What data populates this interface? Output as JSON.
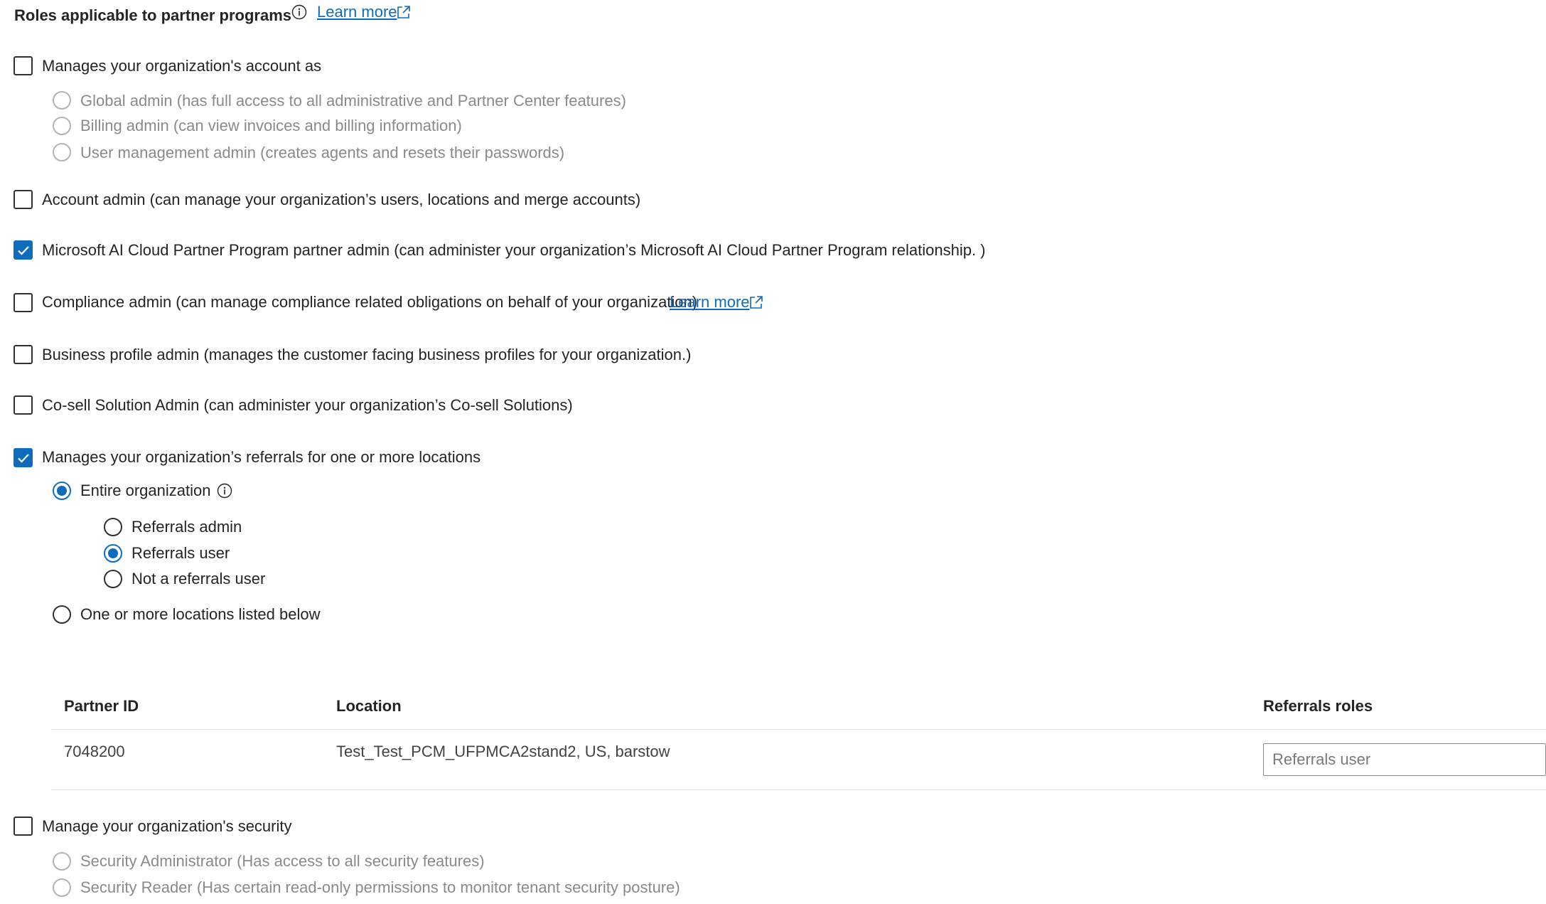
{
  "header": {
    "title": "Roles applicable to partner programs",
    "learn_more": "Learn more",
    "info_icon": "info-icon",
    "external_icon": "external-link-icon"
  },
  "roles": {
    "manages_account": {
      "label": "Manages your organization's account as",
      "checked": false,
      "options": [
        "Global admin (has full access to all administrative and Partner Center features)",
        "Billing admin (can view invoices and billing information)",
        "User management admin (creates agents and resets their passwords)"
      ]
    },
    "account_admin": {
      "label": "Account admin (can manage your organization’s users, locations and merge accounts)",
      "checked": false
    },
    "ai_cloud_admin": {
      "label": "Microsoft AI Cloud Partner Program partner admin (can administer your organization’s Microsoft AI Cloud Partner Program relationship. )",
      "checked": true
    },
    "compliance_admin": {
      "label": "Compliance admin (can manage compliance related obligations on behalf of your organization)",
      "learn_more": "Learn more",
      "checked": false
    },
    "business_profile_admin": {
      "label": "Business profile admin (manages the customer facing business profiles for your organization.)",
      "checked": false
    },
    "cosell_admin": {
      "label": "Co-sell Solution Admin (can administer your organization’s Co-sell Solutions)",
      "checked": false
    },
    "referrals": {
      "label": "Manages your organization’s referrals for one or more locations",
      "checked": true,
      "entire_org": "Entire organization",
      "sub_options": [
        "Referrals admin",
        "Referrals user",
        "Not a referrals user"
      ],
      "selected_sub_option": "Referrals user",
      "one_or_more": "One or more locations listed below"
    },
    "security": {
      "label": "Manage your organization's security",
      "checked": false,
      "options": [
        "Security Administrator (Has access to all security features)",
        "Security Reader (Has certain read-only permissions to monitor tenant security posture)"
      ]
    }
  },
  "locations_table": {
    "headers": [
      "Partner ID",
      "Location",
      "Referrals roles"
    ],
    "rows": [
      {
        "partner_id": "7048200",
        "location": "Test_Test_PCM_UFPMCA2stand2, US, barstow",
        "referrals_role": "Referrals user"
      }
    ]
  },
  "colors": {
    "accent": "#0f6cbd",
    "text": "#242424",
    "disabled": "#8a8a8a"
  }
}
